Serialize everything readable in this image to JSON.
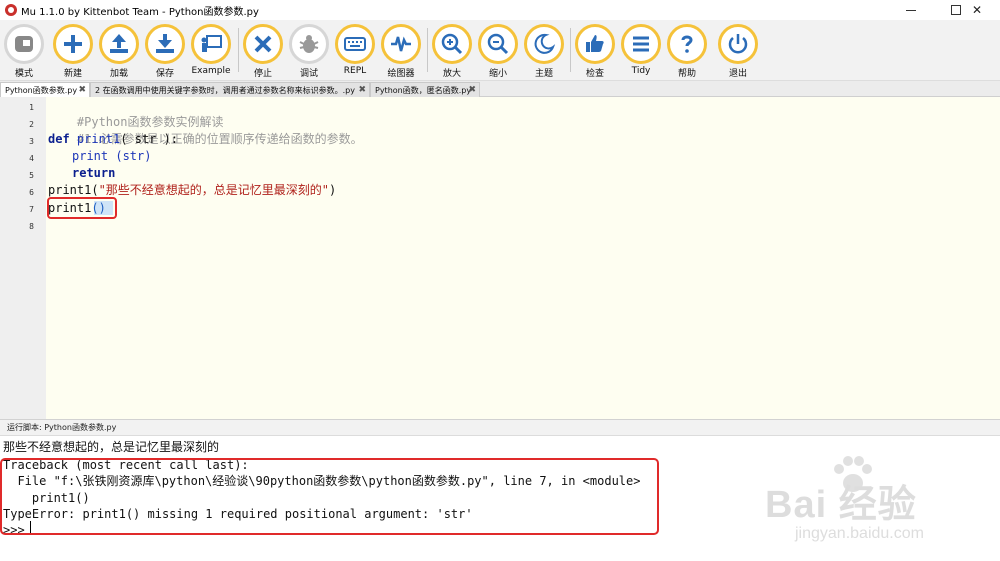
{
  "window": {
    "title": "Mu 1.1.0 by Kittenbot Team - Python函数参数.py",
    "close_glyph": "✕"
  },
  "toolbar": {
    "buttons": [
      {
        "label": "模式",
        "icon": "mode-icon"
      },
      {
        "label": "新建",
        "icon": "plus-icon"
      },
      {
        "label": "加载",
        "icon": "upload-icon"
      },
      {
        "label": "保存",
        "icon": "download-icon"
      },
      {
        "label": "Example",
        "icon": "teacher-board-icon"
      },
      {
        "label": "停止",
        "icon": "x-icon"
      },
      {
        "label": "调试",
        "icon": "bug-icon"
      },
      {
        "label": "REPL",
        "icon": "keyboard-icon"
      },
      {
        "label": "绘图器",
        "icon": "pulse-icon"
      },
      {
        "label": "放大",
        "icon": "zoom-in-icon"
      },
      {
        "label": "缩小",
        "icon": "zoom-out-icon"
      },
      {
        "label": "主题",
        "icon": "moon-icon"
      },
      {
        "label": "检查",
        "icon": "thumbs-up-icon"
      },
      {
        "label": "Tidy",
        "icon": "lines-icon"
      },
      {
        "label": "帮助",
        "icon": "question-icon"
      },
      {
        "label": "退出",
        "icon": "power-icon"
      }
    ]
  },
  "tabs": [
    {
      "label": "Python函数参数.py",
      "active": true
    },
    {
      "label": "2 在函数调用中使用关键字参数时，调用者通过参数名称来标识参数。.py",
      "active": false
    },
    {
      "label": "Python函数，匿名函数.py",
      "active": false
    }
  ],
  "editor": {
    "line_numbers": [
      "1",
      "2",
      "3",
      "4",
      "5",
      "6",
      "7",
      "8"
    ],
    "lines": {
      "l1": "#Python函数参数实例解读",
      "l2": "#1.必需参数是以正确的位置顺序传递给函数的参数。",
      "l3_kw": "def",
      "l3_name": " print1",
      "l3_rest": "( str ):",
      "l4_builtin": "print",
      "l4_rest": " (str)",
      "l5_kw": "return",
      "l6_pre": "print1(",
      "l6_str": "\"那些不经意想起的，总是记忆里最深刻的\"",
      "l6_post": ")",
      "l7_name": "print1",
      "l7_brace": "()"
    }
  },
  "repl": {
    "header": "运行脚本: Python函数参数.py",
    "lines": [
      "那些不经意想起的，总是记忆里最深刻的",
      "Traceback (most recent call last):",
      "  File \"f:\\张铁刚资源库\\python\\经验谈\\90python函数参数\\python函数参数.py\", line 7, in <module>",
      "    print1()",
      "TypeError: print1() missing 1 required positional argument: 'str'",
      ">>> "
    ]
  },
  "watermark": {
    "brand": "Bai  经验",
    "url": "jingyan.baidu.com"
  },
  "colors": {
    "accent_ring": "#f5c23a",
    "icon_blue": "#2b6cb8",
    "highlight_red": "#e02a2a",
    "editor_bg": "#fefef1"
  }
}
